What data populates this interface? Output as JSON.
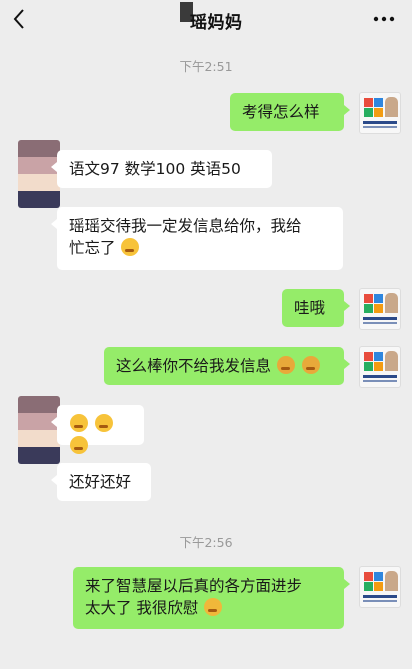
{
  "header": {
    "title": "瑶妈妈"
  },
  "timestamps": [
    "下午2:51",
    "下午2:56"
  ],
  "messages": [
    {
      "side": "me",
      "text": "考得怎么样"
    },
    {
      "side": "them",
      "text": "语文97  数学100  英语50"
    },
    {
      "side": "them",
      "text_line1": "瑶瑶交待我一定发信息给你，我给",
      "text_line2": "忙忘了"
    },
    {
      "side": "me",
      "text": "哇哦"
    },
    {
      "side": "me",
      "text": "这么棒你不给我发信息"
    },
    {
      "side": "them",
      "text": ""
    },
    {
      "side": "them",
      "text": "还好还好"
    },
    {
      "side": "me",
      "text_line1": "来了智慧屋以后真的各方面进步",
      "text_line2": "太大了 我很欣慰"
    }
  ],
  "colors": {
    "background": "#ededed",
    "my_bubble": "#95ec69",
    "their_bubble": "#ffffff"
  },
  "icons": [
    "back-arrow-icon",
    "more-dots-icon",
    "thinking-face-emoji",
    "sweating-emoji",
    "grimacing-emoji"
  ]
}
